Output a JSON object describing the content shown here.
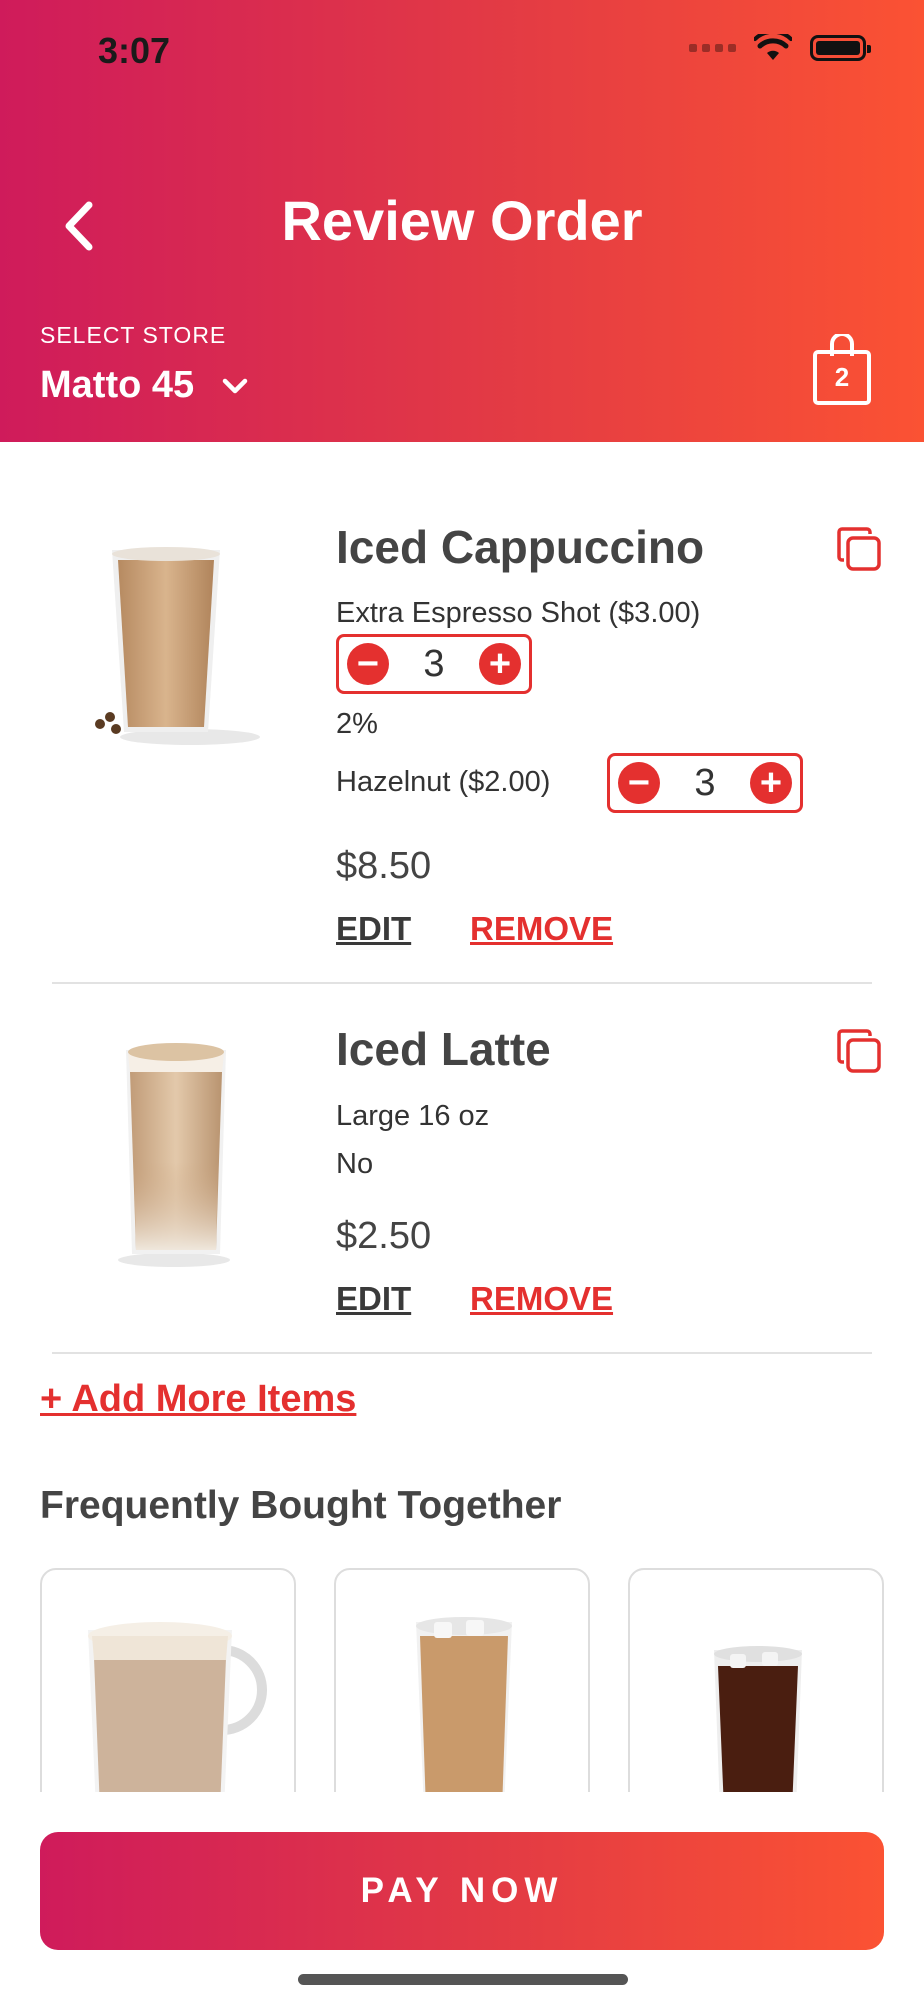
{
  "status_bar": {
    "time": "3:07"
  },
  "header": {
    "title": "Review Order",
    "store_label": "SELECT STORE",
    "store_name": "Matto 45",
    "cart_count": "2"
  },
  "items": [
    {
      "name": "Iced Cappuccino",
      "option_1": "Extra Espresso Shot ($3.00)",
      "option_1_qty": "3",
      "option_2": "2%",
      "option_3": "Hazelnut ($2.00)",
      "option_3_qty": "3",
      "price": "$8.50",
      "edit_label": "EDIT",
      "remove_label": "REMOVE"
    },
    {
      "name": "Iced Latte",
      "option_1": "Large 16 oz",
      "option_2": "No",
      "price": "$2.50",
      "edit_label": "EDIT",
      "remove_label": "REMOVE"
    }
  ],
  "add_more_label": "+ Add More Items",
  "fbt": {
    "title": "Frequently Bought Together"
  },
  "pay_button_label": "PAY NOW",
  "colors": {
    "accent": "#e4302f",
    "gradient_start": "#cf1b5b",
    "gradient_end": "#fb5233"
  }
}
